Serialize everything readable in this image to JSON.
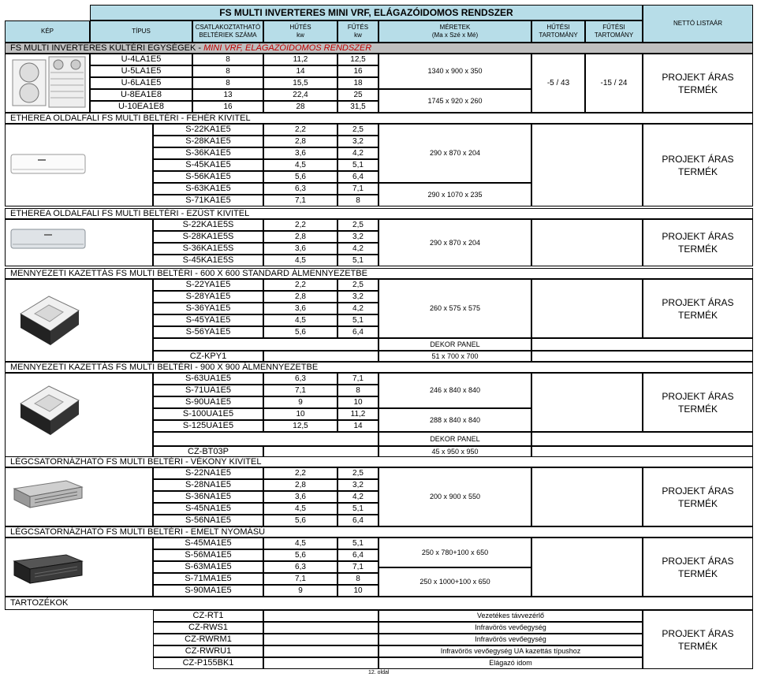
{
  "title": "FS MULTI INVERTERES MINI VRF, ELÁGAZÓIDOMOS RENDSZER",
  "headers": {
    "kep": "KÉP",
    "tipus": "TÍPUS",
    "csatl_line1": "CSATLAKOZTATHATÓ",
    "csatl_line2": "BELTÉRIEK SZÁMA",
    "hutes_line1": "HŰTÉS",
    "hutes_line2": "kw",
    "futes_line1": "FŰTÉS",
    "futes_line2": "kw",
    "meretek_line1": "MÉRETEK",
    "meretek_line2": "(Ma x Szé x Mé)",
    "hutesi_t_line1": "HŰTÉSI",
    "hutesi_t_line2": "TARTOMÁNY",
    "futesi_t_line1": "FŰTÉSI",
    "futesi_t_line2": "TARTOMÁNY",
    "netto": "NETTÓ LISTAÁR"
  },
  "price_label_1": "PROJEKT ÁRAS",
  "price_label_2": "TERMÉK",
  "outdoor": {
    "band_plain": "FS MULTI INVERTERES KÜLTÉRI EGYSÉGEK - ",
    "band_red": "MINI VRF, ELÁGAZÓIDOMOS RENDSZER",
    "rows": [
      {
        "model": "U-4LA1E5",
        "units": "8",
        "cool": "11,2",
        "heat": "12,5"
      },
      {
        "model": "U-5LA1E5",
        "units": "8",
        "cool": "14",
        "heat": "16"
      },
      {
        "model": "U-6LA1E5",
        "units": "8",
        "cool": "15,5",
        "heat": "18"
      },
      {
        "model": "U-8EA1E8",
        "units": "13",
        "cool": "22,4",
        "heat": "25"
      },
      {
        "model": "U-10EA1E8",
        "units": "16",
        "cool": "28",
        "heat": "31,5"
      }
    ],
    "dim_1": "1340 x 900 x 350",
    "dim_2": "1745 x 920 x 260",
    "cool_range": "-5 / 43",
    "heat_range": "-15 / 24"
  },
  "wall_white": {
    "title": "ETHEREA OLDALFALI FS MULTI BELTÉRI - FEHÉR KIVITEL",
    "rows": [
      {
        "model": "S-22KA1E5",
        "cool": "2,2",
        "heat": "2,5"
      },
      {
        "model": "S-28KA1E5",
        "cool": "2,8",
        "heat": "3,2"
      },
      {
        "model": "S-36KA1E5",
        "cool": "3,6",
        "heat": "4,2"
      },
      {
        "model": "S-45KA1E5",
        "cool": "4,5",
        "heat": "5,1"
      },
      {
        "model": "S-56KA1E5",
        "cool": "5,6",
        "heat": "6,4"
      },
      {
        "model": "S-63KA1E5",
        "cool": "6,3",
        "heat": "7,1"
      },
      {
        "model": "S-71KA1E5",
        "cool": "7,1",
        "heat": "8"
      }
    ],
    "dim_1": "290 x 870 x 204",
    "dim_2": "290 x 1070 x 235"
  },
  "wall_silver": {
    "title": "ETHEREA OLDALFALI FS MULTI BELTÉRI - EZÜST KIVITEL",
    "rows": [
      {
        "model": "S-22KA1E5S",
        "cool": "2,2",
        "heat": "2,5"
      },
      {
        "model": "S-28KA1E5S",
        "cool": "2,8",
        "heat": "3,2"
      },
      {
        "model": "S-36KA1E5S",
        "cool": "3,6",
        "heat": "4,2"
      },
      {
        "model": "S-45KA1E5S",
        "cool": "4,5",
        "heat": "5,1"
      }
    ],
    "dim_1": "290 x 870 x 204"
  },
  "cassette_600": {
    "title": "MENNYEZETI KAZETTÁS FS MULTI BELTÉRI - 600 X 600 STANDARD ÁLMENNYEZETBE",
    "rows": [
      {
        "model": "S-22YA1E5",
        "cool": "2,2",
        "heat": "2,5"
      },
      {
        "model": "S-28YA1E5",
        "cool": "2,8",
        "heat": "3,2"
      },
      {
        "model": "S-36YA1E5",
        "cool": "3,6",
        "heat": "4,2"
      },
      {
        "model": "S-45YA1E5",
        "cool": "4,5",
        "heat": "5,1"
      },
      {
        "model": "S-56YA1E5",
        "cool": "5,6",
        "heat": "6,4"
      }
    ],
    "dim_1": "260 x 575 x 575",
    "panel_label": "DEKOR PANEL",
    "panel_model": "CZ-KPY1",
    "panel_dim": "51 x 700 x 700"
  },
  "cassette_900": {
    "title": "MENNYEZETI KAZETTÁS FS MULTI BELTÉRI - 900 X 900 ÁLMENNYEZETBE",
    "rows": [
      {
        "model": "S-63UA1E5",
        "cool": "6,3",
        "heat": "7,1"
      },
      {
        "model": "S-71UA1E5",
        "cool": "7,1",
        "heat": "8"
      },
      {
        "model": "S-90UA1E5",
        "cool": "9",
        "heat": "10"
      },
      {
        "model": "S-100UA1E5",
        "cool": "10",
        "heat": "11,2"
      },
      {
        "model": "S-125UA1E5",
        "cool": "12,5",
        "heat": "14"
      }
    ],
    "dim_1": "246 x 840 x 840",
    "dim_2": "288 x 840 x 840",
    "panel_label": "DEKOR PANEL",
    "panel_model": "CZ-BT03P",
    "panel_dim": "45 x 950 x 950"
  },
  "duct_slim": {
    "title": "LÉGCSATORNÁZHATÓ FS MULTI BELTÉRI - VÉKONY KIVITEL",
    "rows": [
      {
        "model": "S-22NA1E5",
        "cool": "2,2",
        "heat": "2,5"
      },
      {
        "model": "S-28NA1E5",
        "cool": "2,8",
        "heat": "3,2"
      },
      {
        "model": "S-36NA1E5",
        "cool": "3,6",
        "heat": "4,2"
      },
      {
        "model": "S-45NA1E5",
        "cool": "4,5",
        "heat": "5,1"
      },
      {
        "model": "S-56NA1E5",
        "cool": "5,6",
        "heat": "6,4"
      }
    ],
    "dim_1": "200 x 900 x 550"
  },
  "duct_high": {
    "title": "LÉGCSATORNÁZHATÓ FS MULTI BELTÉRI - EMELT NYOMÁSÚ",
    "rows": [
      {
        "model": "S-45MA1E5",
        "cool": "4,5",
        "heat": "5,1"
      },
      {
        "model": "S-56MA1E5",
        "cool": "5,6",
        "heat": "6,4"
      },
      {
        "model": "S-63MA1E5",
        "cool": "6,3",
        "heat": "7,1"
      },
      {
        "model": "S-71MA1E5",
        "cool": "7,1",
        "heat": "8"
      },
      {
        "model": "S-90MA1E5",
        "cool": "9",
        "heat": "10"
      }
    ],
    "dim_1": "250 x 780+100 x 650",
    "dim_2": "250 x 1000+100 x 650"
  },
  "accessories": {
    "title": "TARTOZÉKOK",
    "rows": [
      {
        "model": "CZ-RT1",
        "desc": "Vezetékes távvezérlő"
      },
      {
        "model": "CZ-RWS1",
        "desc": "Infravörös vevőegység"
      },
      {
        "model": "CZ-RWRM1",
        "desc": "Infravörös vevőegység"
      },
      {
        "model": "CZ-RWRU1",
        "desc": "Infravörös vevőegység UA kazettás típushoz"
      },
      {
        "model": "CZ-P155BK1",
        "desc": "Elágazó idom"
      }
    ]
  },
  "page_number": "12. oldal",
  "colors": {
    "header_bg": "#b7dde8",
    "band_bg": "#bfbfbf",
    "accent_red": "#c00000"
  }
}
